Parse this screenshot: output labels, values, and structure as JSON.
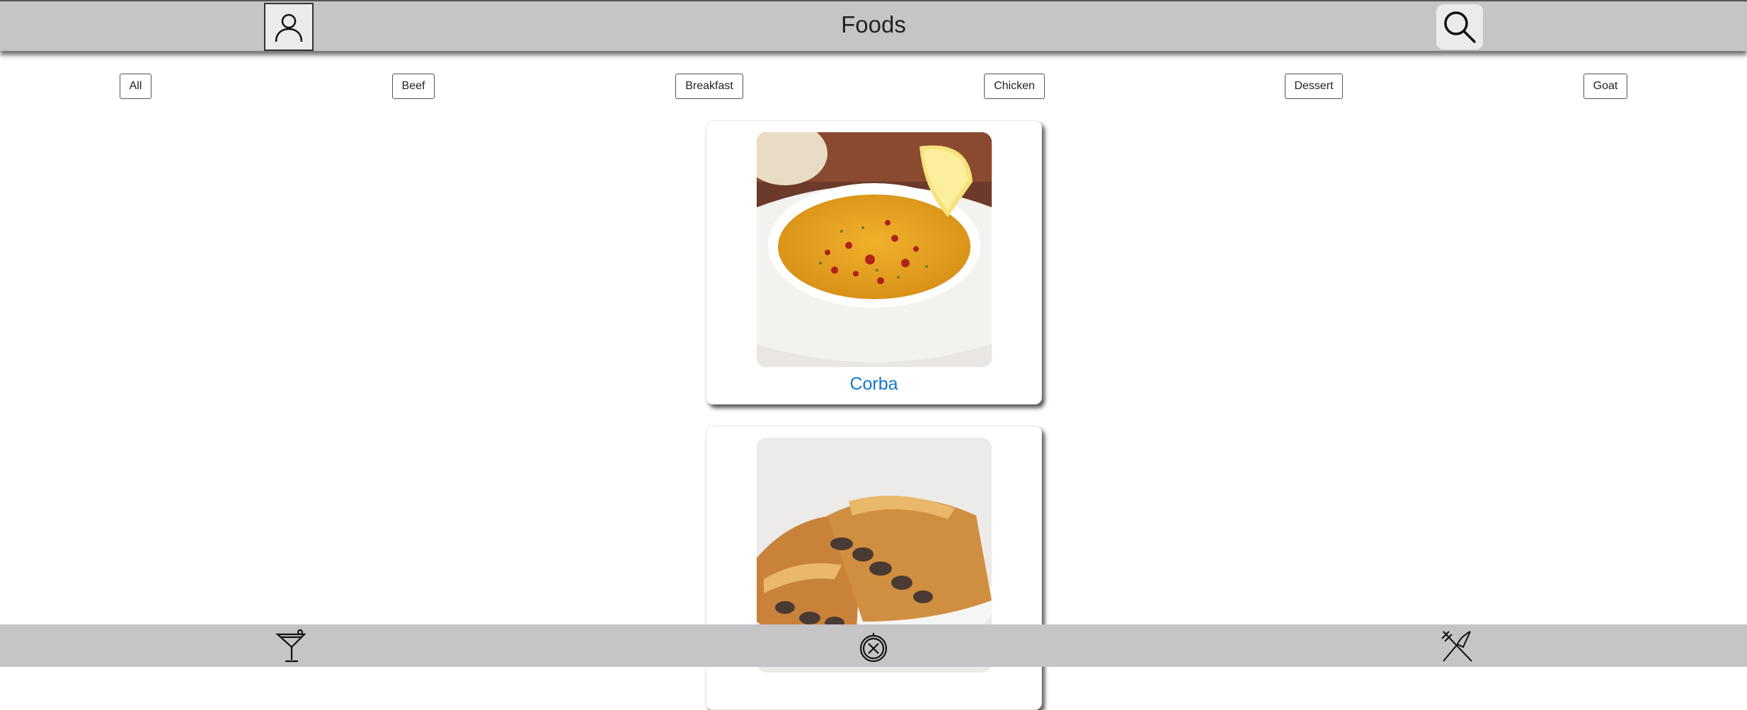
{
  "header": {
    "title": "Foods",
    "profile_icon": "user-icon",
    "search_icon": "search-icon"
  },
  "categories": [
    "All",
    "Beef",
    "Breakfast",
    "Chicken",
    "Dessert",
    "Goat"
  ],
  "foods": [
    {
      "name": "Corba",
      "image": "lentil-soup-bowl-with-lemon"
    },
    {
      "name": "",
      "image": "meat-burek-pastry"
    }
  ],
  "bottom_nav": {
    "items": [
      "cocktail-icon",
      "compass-icon",
      "fork-knife-icon"
    ]
  },
  "colors": {
    "bar_background": "#c5c4c6",
    "food_name": "#1478c8"
  }
}
